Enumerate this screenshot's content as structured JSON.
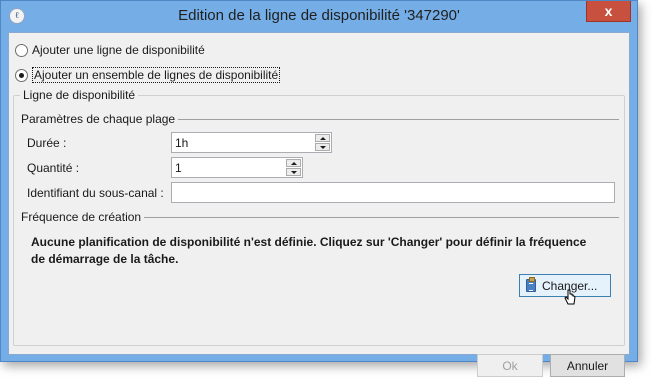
{
  "window": {
    "title": "Edition de la ligne de disponibilité '347290'",
    "close_glyph": "x"
  },
  "options": {
    "add_single_label": "Ajouter une ligne de disponibilité",
    "add_set_label": "Ajouter un ensemble de lignes de disponibilité",
    "selected": "add_set"
  },
  "availability_group": {
    "title": "Ligne de disponibilité",
    "range_section_title": "Paramètres de chaque plage",
    "duration_label": "Durée :",
    "duration_value": "1h",
    "quantity_label": "Quantité :",
    "quantity_value": "1",
    "subchannel_label": "Identifiant du sous-canal :",
    "subchannel_value": "",
    "frequency_section_title": "Fréquence de création",
    "frequency_message": "Aucune planification de disponibilité n'est définie. Cliquez sur 'Changer' pour définir la fréquence de démarrage de la tâche.",
    "change_button_label": "Changer..."
  },
  "footer": {
    "ok_label": "Ok",
    "cancel_label": "Annuler"
  },
  "colors": {
    "title_bar": "#75aee6",
    "close_button": "#c7503f",
    "dialog_background": "#f0f0f0",
    "focused_button": "#e5f1fb"
  },
  "icons": [
    "app-icon",
    "close-icon",
    "spin-up-icon",
    "spin-down-icon",
    "clipboard-icon",
    "mouse-cursor-icon"
  ]
}
